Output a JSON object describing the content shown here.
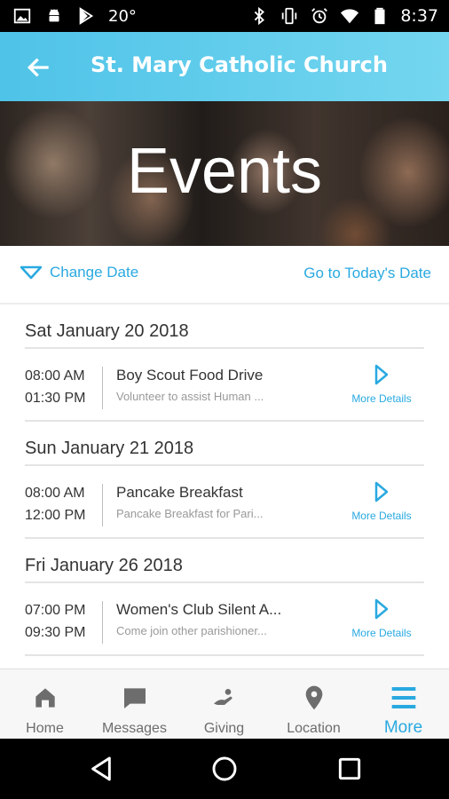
{
  "status_bar": {
    "temperature": "20°",
    "time": "8:37",
    "left_icons": [
      "image-icon",
      "android-icon",
      "play-store-icon"
    ],
    "right_icons": [
      "bluetooth-icon",
      "vibrate-icon",
      "alarm-icon",
      "wifi-icon",
      "battery-icon"
    ]
  },
  "app_bar": {
    "title": "St. Mary Catholic Church",
    "color": "#4fc3e8"
  },
  "hero": {
    "title": "Events"
  },
  "date_controls": {
    "change_date_label": "Change Date",
    "today_label": "Go to Today's Date",
    "accent": "#29a9e0"
  },
  "events": [
    {
      "date": "Sat January 20 2018",
      "start": "08:00 AM",
      "end": "01:30 PM",
      "title": "Boy Scout Food Drive",
      "description": "Volunteer to assist Human ...",
      "more_label": "More Details"
    },
    {
      "date": "Sun January 21 2018",
      "start": "08:00 AM",
      "end": "12:00 PM",
      "title": "Pancake Breakfast",
      "description": "Pancake Breakfast for Pari...",
      "more_label": "More Details"
    },
    {
      "date": "Fri January 26 2018",
      "start": "07:00 PM",
      "end": "09:30 PM",
      "title": "Women's Club Silent A...",
      "description": "Come join other parishioner...",
      "more_label": "More Details"
    }
  ],
  "bottom_nav": {
    "items": [
      {
        "label": "Home",
        "icon": "home-icon"
      },
      {
        "label": "Messages",
        "icon": "message-icon"
      },
      {
        "label": "Giving",
        "icon": "giving-icon"
      },
      {
        "label": "Location",
        "icon": "location-pin-icon"
      },
      {
        "label": "More",
        "icon": "menu-icon",
        "active": true
      }
    ]
  }
}
